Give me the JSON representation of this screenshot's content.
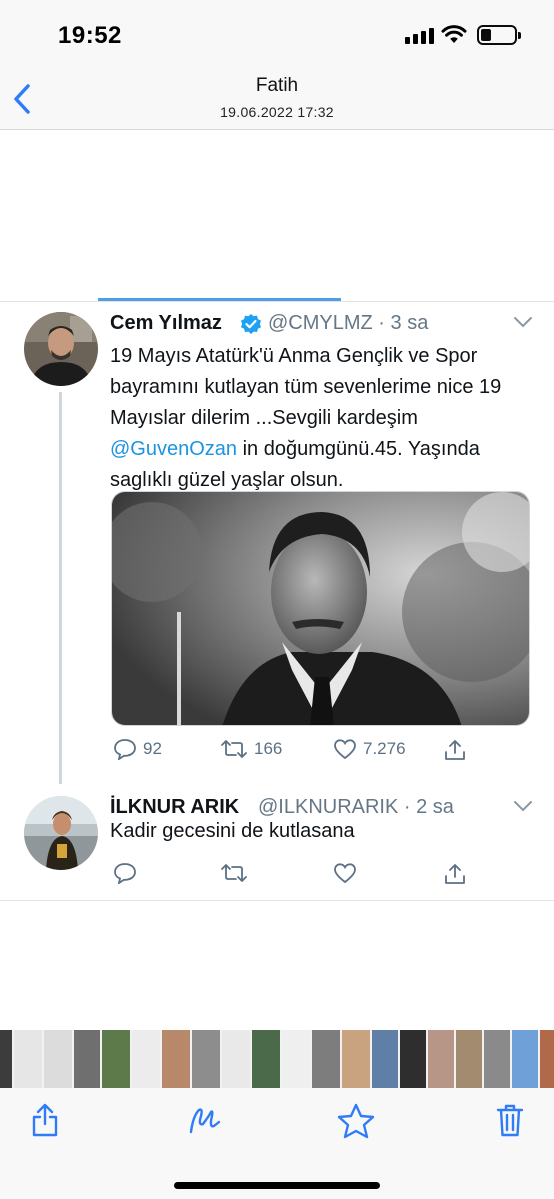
{
  "status_bar": {
    "time": "19:52"
  },
  "nav": {
    "title": "Fatih",
    "subtitle": "19.06.2022 17:32"
  },
  "tweets": [
    {
      "name": "Cem Yılmaz",
      "handle": "@CMYLMZ · 3 sa",
      "text_before": "19 Mayıs Atatürk'ü Anma Gençlik ve Spor bayramını kutlayan tüm sevenlerime nice 19 Mayıslar dilerim ...Sevgili kardeşim ",
      "mention": "@GuvenOzan",
      "text_after": " in doğumgünü.45. Yaşında saglıklı güzel yaşlar olsun.",
      "replies": "92",
      "retweets": "166",
      "likes": "7.276"
    },
    {
      "name": "İLKNUR ARIK",
      "handle": "@ILKNURARIK · 2 sa",
      "text": "Kadir gecesini de kutlasana"
    }
  ],
  "colors": {
    "link": "#1b95e0",
    "ios_blue": "#2f7cf6",
    "muted": "#657786"
  }
}
